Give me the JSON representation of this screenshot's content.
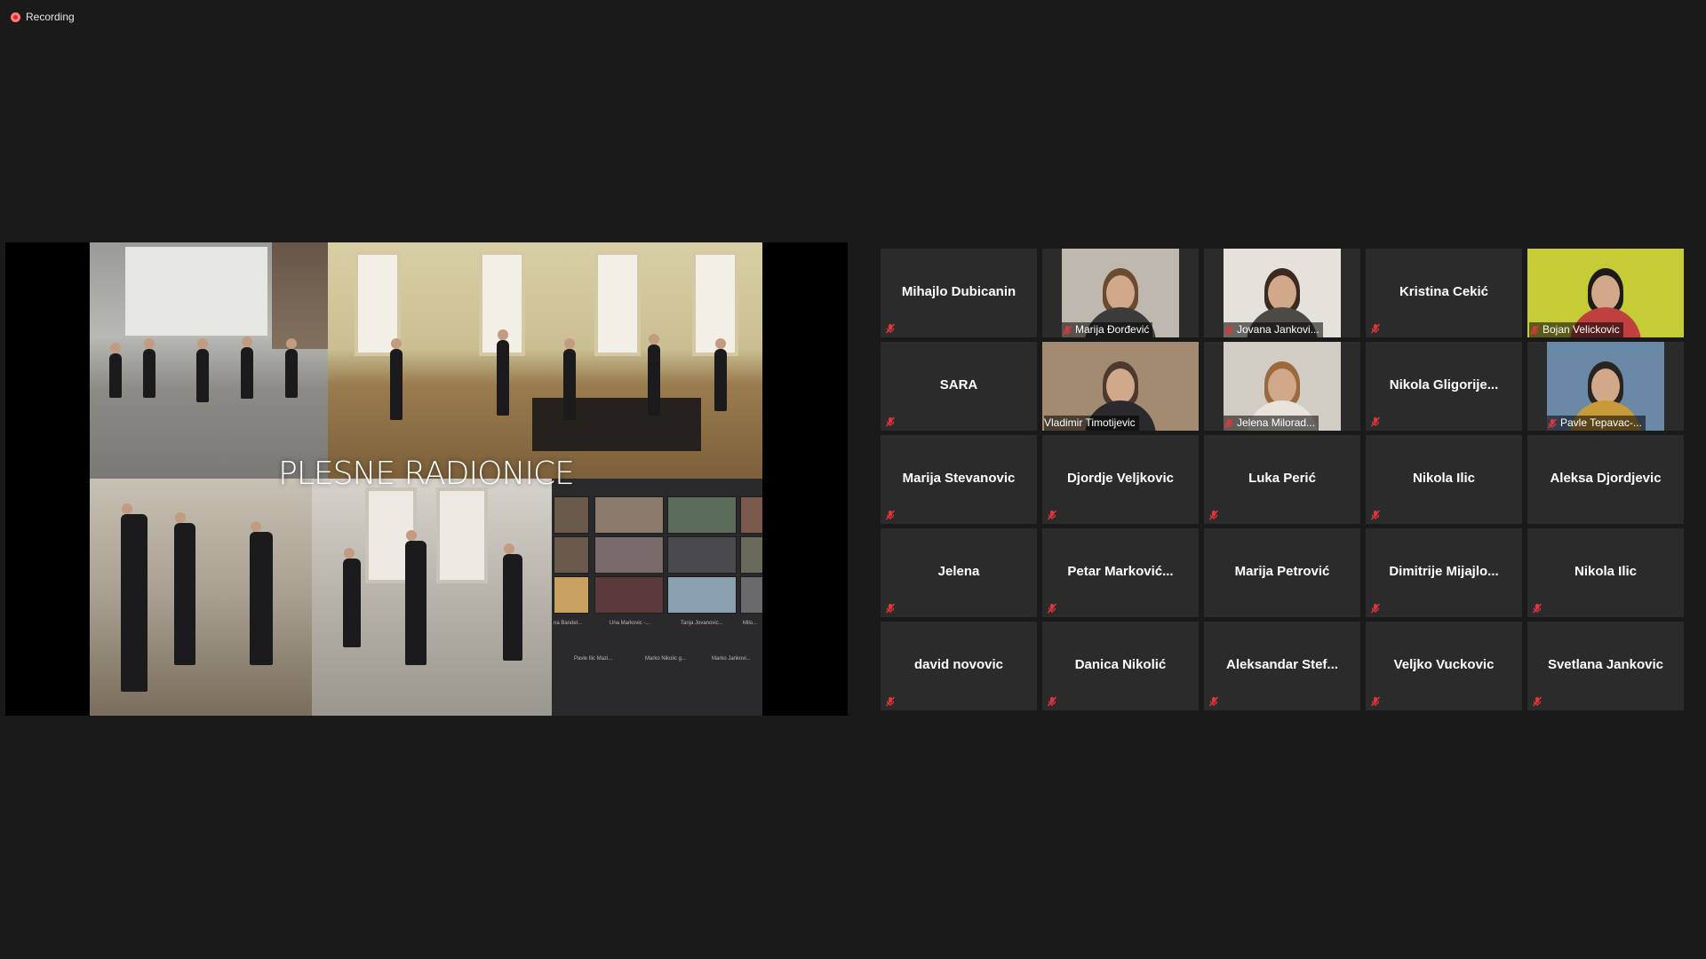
{
  "recording": {
    "label": "Recording"
  },
  "share": {
    "slide_title": "PLESNE RADIONICE",
    "mini_names": [
      "na Bandel...",
      "Una Markovic -...",
      "Tanja Jovanovic...",
      "Milo...",
      "Pavle Ilic Mazi...",
      "Marko Nikolic g...",
      "Marko Jankovi..."
    ]
  },
  "colors": {
    "background": "#1a1a1a",
    "tile": "#2b2b2b",
    "active_speaker": "#d8e85a",
    "muted_icon": "#e0363a"
  },
  "participants": [
    {
      "name": "Mihajlo Dubicanin",
      "video": false,
      "muted": true
    },
    {
      "name": "Marija Đorđević",
      "video": true,
      "muted": true,
      "bg": "#bfb8ae",
      "shirt": "#3b3b3b",
      "hair": "#6b4a30"
    },
    {
      "name": "Jovana Jankovi...",
      "video": true,
      "muted": true,
      "bg": "#e4e2da",
      "shirt": "#4b4a45",
      "hair": "#3a2a20"
    },
    {
      "name": "Kristina Cekić",
      "video": false,
      "muted": true
    },
    {
      "name": "Bojan Velickovic",
      "video": true,
      "full": true,
      "muted": true,
      "bg": "#c6cc36",
      "shirt": "#c04040",
      "hair": "#1e1a18"
    },
    {
      "name": "SARA",
      "video": false,
      "muted": true
    },
    {
      "name": "Vladimir Timotijevic",
      "video": true,
      "full": true,
      "active": true,
      "muted": false,
      "bg": "#a38b72",
      "shirt": "#2a2a2e",
      "hair": "#4b3a2d"
    },
    {
      "name": "Jelena Milorad...",
      "video": true,
      "muted": true,
      "bg": "#d2cdc4",
      "shirt": "#e8e4dc",
      "hair": "#9a6a3c"
    },
    {
      "name": "Nikola  Gligorije...",
      "video": false,
      "muted": true
    },
    {
      "name": "Pavle Tepavac-...",
      "video": true,
      "muted": true,
      "bg": "#6a89a6",
      "shirt": "#c89a3a",
      "hair": "#2a2420"
    },
    {
      "name": "Marija Stevanovic",
      "video": false,
      "muted": true
    },
    {
      "name": "Djordje Veljkovic",
      "video": false,
      "muted": true
    },
    {
      "name": "Luka Perić",
      "video": false,
      "muted": true
    },
    {
      "name": "Nikola Ilic",
      "video": false,
      "muted": true
    },
    {
      "name": "Aleksa Djordjevic",
      "video": false,
      "muted": false
    },
    {
      "name": "Jelena",
      "video": false,
      "muted": true
    },
    {
      "name": "Petar  Marković...",
      "video": false,
      "muted": true
    },
    {
      "name": "Marija Petrović",
      "video": false,
      "muted": false
    },
    {
      "name": "Dimitrije  Mijajlo...",
      "video": false,
      "muted": true
    },
    {
      "name": "Nikola Ilic",
      "video": false,
      "muted": true
    },
    {
      "name": "david novovic",
      "video": false,
      "muted": true
    },
    {
      "name": "Danica Nikolić",
      "video": false,
      "muted": true
    },
    {
      "name": "Aleksandar  Stef...",
      "video": false,
      "muted": true
    },
    {
      "name": "Veljko Vuckovic",
      "video": false,
      "muted": true
    },
    {
      "name": "Svetlana Jankovic",
      "video": false,
      "muted": true
    }
  ]
}
